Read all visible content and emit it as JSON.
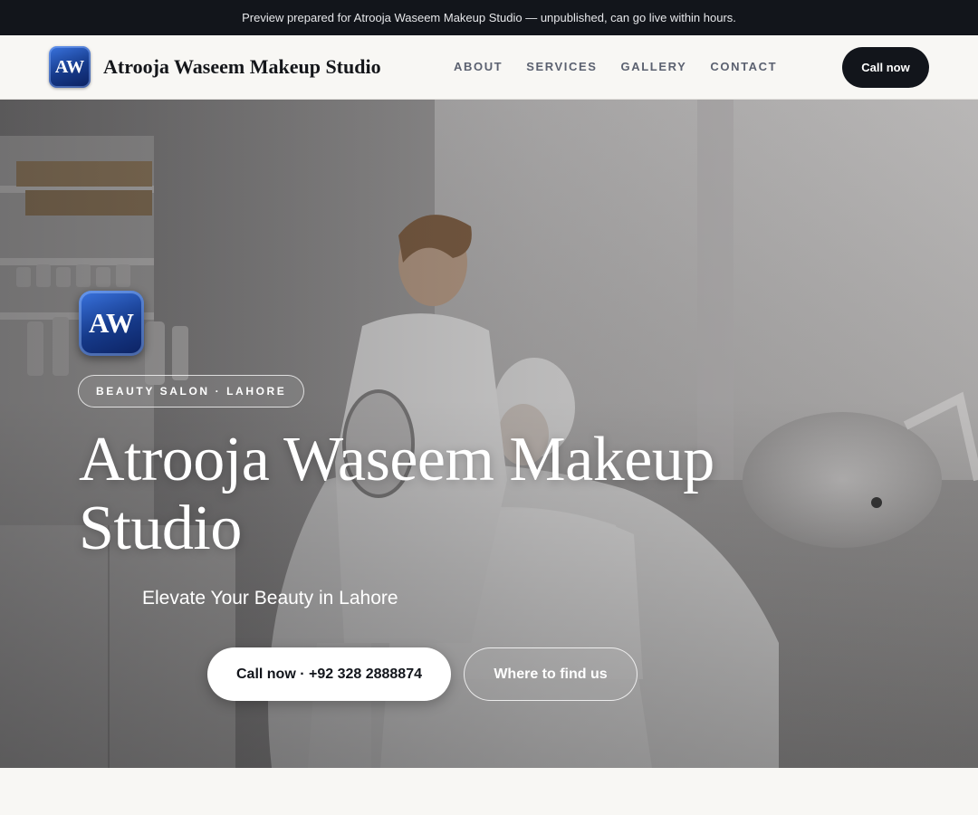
{
  "banner": {
    "text": "Preview prepared for Atrooja Waseem Makeup Studio — unpublished, can go live within hours."
  },
  "header": {
    "logo_initials": "AW",
    "brand_name": "Atrooja Waseem Makeup Studio",
    "nav": [
      {
        "label": "ABOUT"
      },
      {
        "label": "SERVICES"
      },
      {
        "label": "GALLERY"
      },
      {
        "label": "CONTACT"
      }
    ],
    "call_label": "Call now"
  },
  "hero": {
    "logo_initials": "AW",
    "eyebrow": "BEAUTY SALON · LAHORE",
    "title": "Atrooja Waseem Makeup Studio",
    "subtitle": "Elevate Your Beauty in Lahore",
    "primary_cta": "Call now · +92 328 2888874",
    "secondary_cta": "Where to find us"
  },
  "colors": {
    "banner_bg": "#12151b",
    "page_bg": "#f8f7f4",
    "button_dark": "#12151b",
    "logo_blue": "#163a8a",
    "nav_text": "#5b6170"
  }
}
